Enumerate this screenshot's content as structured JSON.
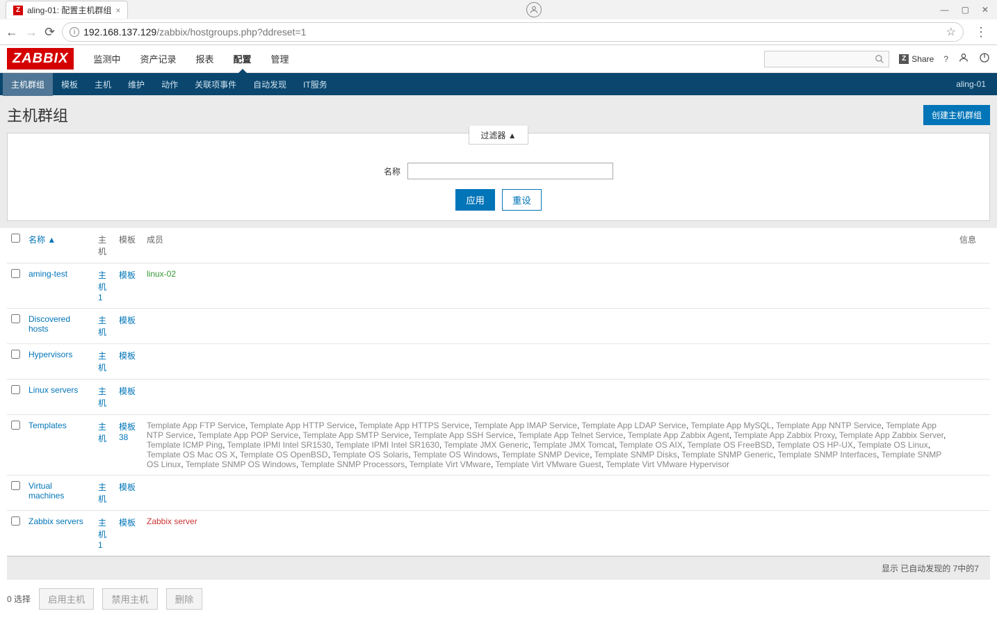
{
  "browser": {
    "tab_title": "aling-01: 配置主机群组",
    "url_host": "192.168.137.129",
    "url_path": "/zabbix/hostgroups.php?ddreset=1"
  },
  "topnav": {
    "logo": "ZABBIX",
    "items": [
      "监测中",
      "资产记录",
      "报表",
      "配置",
      "管理"
    ],
    "active_index": 3,
    "share": "Share"
  },
  "subnav": {
    "items": [
      "主机群组",
      "模板",
      "主机",
      "维护",
      "动作",
      "关联项事件",
      "自动发现",
      "IT服务"
    ],
    "active_index": 0,
    "user": "aling-01"
  },
  "page": {
    "title": "主机群组",
    "create_btn": "创建主机群组"
  },
  "filter": {
    "tab_label": "过滤器 ▲",
    "name_label": "名称",
    "name_value": "",
    "apply": "应用",
    "reset": "重设"
  },
  "table": {
    "headers": {
      "name": "名称 ▲",
      "hosts": "主机",
      "templates": "模板",
      "members": "成员",
      "info": "信息"
    },
    "rows": [
      {
        "name": "aming-test",
        "hosts": "主机 1",
        "templates": "模板",
        "members_green": [
          "linux-02"
        ],
        "members_gray": [],
        "members_red": []
      },
      {
        "name": "Discovered hosts",
        "hosts": "主机",
        "templates": "模板",
        "members_green": [],
        "members_gray": [],
        "members_red": []
      },
      {
        "name": "Hypervisors",
        "hosts": "主机",
        "templates": "模板",
        "members_green": [],
        "members_gray": [],
        "members_red": []
      },
      {
        "name": "Linux servers",
        "hosts": "主机",
        "templates": "模板",
        "members_green": [],
        "members_gray": [],
        "members_red": []
      },
      {
        "name": "Templates",
        "hosts": "主机",
        "templates": "模板 38",
        "members_green": [],
        "members_gray": [
          "Template App FTP Service",
          "Template App HTTP Service",
          "Template App HTTPS Service",
          "Template App IMAP Service",
          "Template App LDAP Service",
          "Template App MySQL",
          "Template App NNTP Service",
          "Template App NTP Service",
          "Template App POP Service",
          "Template App SMTP Service",
          "Template App SSH Service",
          "Template App Telnet Service",
          "Template App Zabbix Agent",
          "Template App Zabbix Proxy",
          "Template App Zabbix Server",
          "Template ICMP Ping",
          "Template IPMI Intel SR1530",
          "Template IPMI Intel SR1630",
          "Template JMX Generic",
          "Template JMX Tomcat",
          "Template OS AIX",
          "Template OS FreeBSD",
          "Template OS HP-UX",
          "Template OS Linux",
          "Template OS Mac OS X",
          "Template OS OpenBSD",
          "Template OS Solaris",
          "Template OS Windows",
          "Template SNMP Device",
          "Template SNMP Disks",
          "Template SNMP Generic",
          "Template SNMP Interfaces",
          "Template SNMP OS Linux",
          "Template SNMP OS Windows",
          "Template SNMP Processors",
          "Template Virt VMware",
          "Template Virt VMware Guest",
          "Template Virt VMware Hypervisor"
        ],
        "members_red": []
      },
      {
        "name": "Virtual machines",
        "hosts": "主机",
        "templates": "模板",
        "members_green": [],
        "members_gray": [],
        "members_red": []
      },
      {
        "name": "Zabbix servers",
        "hosts": "主机 1",
        "templates": "模板",
        "members_green": [],
        "members_gray": [],
        "members_red": [
          "Zabbix server"
        ]
      }
    ],
    "footer": "显示 已自动发现的 7中的7"
  },
  "actions": {
    "selected": "0 选择",
    "enable": "启用主机",
    "disable": "禁用主机",
    "delete": "删除"
  }
}
